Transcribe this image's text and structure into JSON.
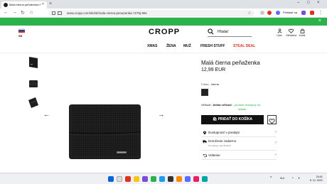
{
  "browser": {
    "tab_title": "Malá čierna peňaženka Farba čierna",
    "tab_close": "×",
    "new_tab": "+",
    "url": "www.cropp.com/sk/sk/mala-cierna-penazenka-7275j-99x",
    "profile_label": "Prihlásiť sa",
    "window_controls": [
      "–",
      "□",
      "×"
    ]
  },
  "banner": {
    "color": "#2bb24c",
    "close": "×"
  },
  "header": {
    "flag": [
      "#ffffff",
      "#0b4ea2",
      "#ee1c25"
    ],
    "lang": "SK",
    "logo": "CROPP",
    "search_label": "Hľadať",
    "icons": [
      {
        "name": "user-icon",
        "label": "Účet"
      },
      {
        "name": "heart-icon",
        "label": "Obľúbené"
      },
      {
        "name": "bag-icon",
        "label": "Košík"
      }
    ]
  },
  "menu": {
    "items": [
      "XMAS",
      "ŽENA",
      "MUŽ",
      "FRESH STUFF",
      "STEAL DEAL"
    ],
    "highlight_color": "#e0301e"
  },
  "gallery": {
    "prev": "←",
    "next": "→"
  },
  "product": {
    "name": "Malá čierna peňaženka",
    "price": "12,99 EUR",
    "color_label": "Farba",
    "color_value": "čierna",
    "size_label": "Veľkosť:",
    "size_value": "Jedna veľkosť",
    "stock_text": "produkt dostupný na",
    "stock_text2": "sklade",
    "buy_label": "PRIDAŤ DO KOŠÍKA",
    "accordions": [
      {
        "name": "availability",
        "label": "Dostupnosť v predajni",
        "sub": ""
      },
      {
        "name": "delivery",
        "label": "Doručenie zadarmo",
        "sub": "Pri nákupe nad 40 EUR"
      },
      {
        "name": "returns",
        "label": "Vrátenie",
        "sub": ""
      }
    ]
  },
  "taskbar": {
    "lang": "SLK",
    "time": "20:43",
    "date": "8. 12. 2023"
  }
}
